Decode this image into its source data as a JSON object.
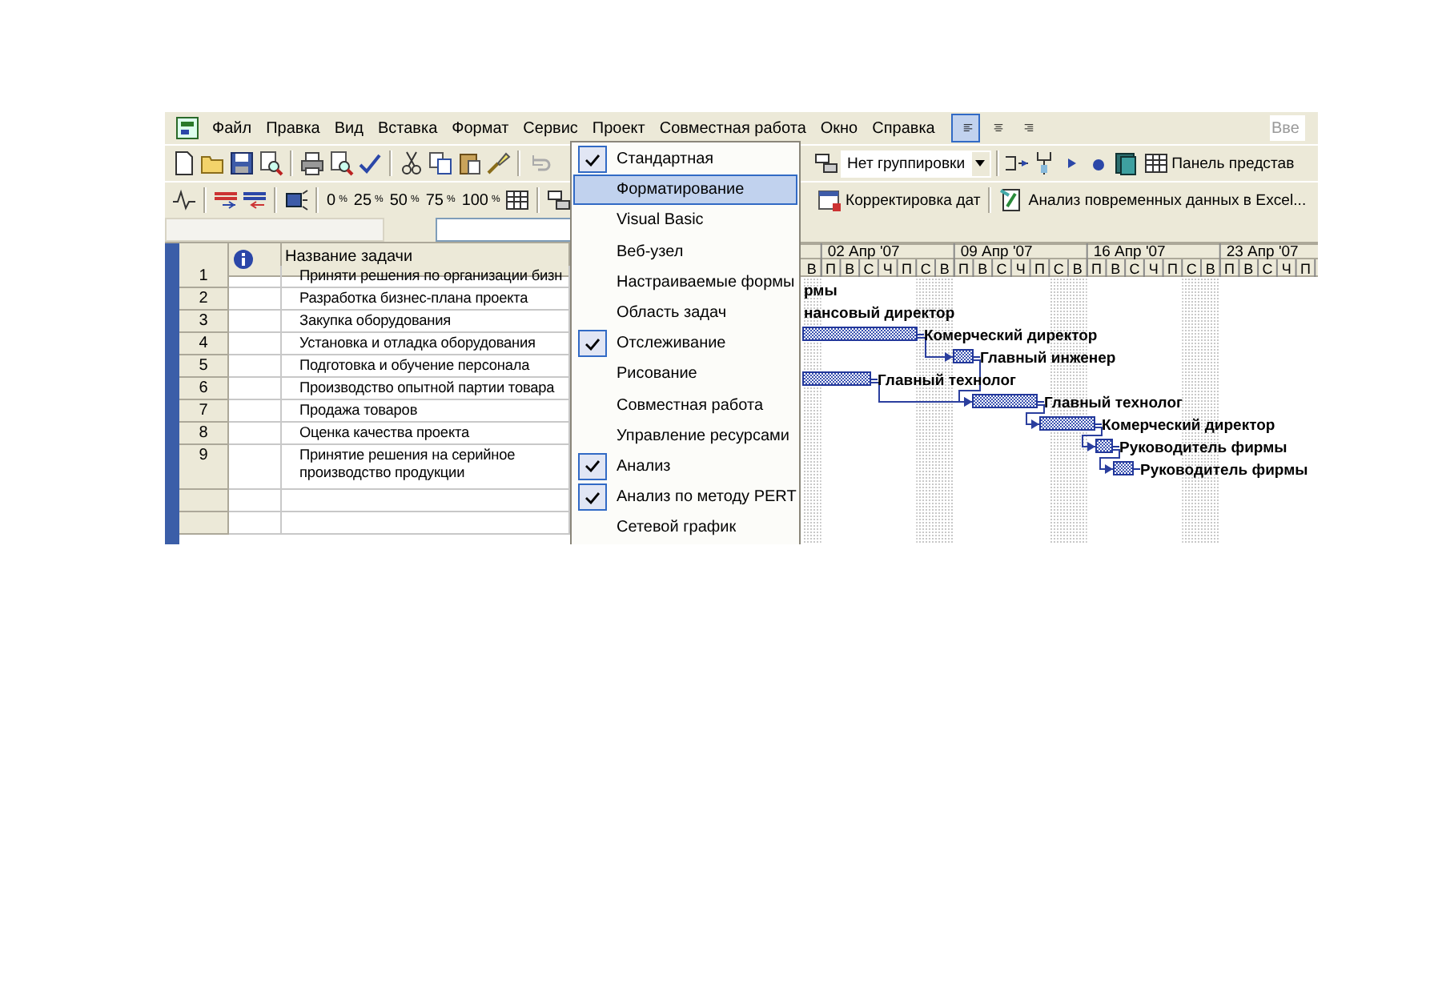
{
  "menu_bar": {
    "items": [
      "Файл",
      "Правка",
      "Вид",
      "Вставка",
      "Формат",
      "Сервис",
      "Проект",
      "Совместная работа",
      "Окно",
      "Справка"
    ],
    "align_buttons": [
      {
        "selected": true
      },
      {
        "selected": false
      },
      {
        "selected": false
      }
    ],
    "question_field": {
      "placeholder": "Вве"
    }
  },
  "standard_toolbar": {
    "grouping_dropdown": "Нет группировки",
    "view_bar_button": "Панель представ"
  },
  "tracking_toolbar": {
    "zoom_buttons": [
      "0$^{%}$",
      "25$^{%}$",
      "50$^{%}$",
      "75$^{%}$",
      "100$^{%}$"
    ],
    "buttons": [
      "Корректировка дат",
      "Анализ повременных данных в Excel..."
    ]
  },
  "task_table": {
    "name_header": "Название задачи",
    "rows": [
      {
        "id": "1",
        "name": "Приняти решения по организации бизн"
      },
      {
        "id": "2",
        "name": "Разработка бизнес-плана проекта"
      },
      {
        "id": "3",
        "name": "Закупка оборудования"
      },
      {
        "id": "4",
        "name": "Установка и отладка оборудования"
      },
      {
        "id": "5",
        "name": "Подготовка и обучение  персонала"
      },
      {
        "id": "6",
        "name": "Производство опытной партии товара"
      },
      {
        "id": "7",
        "name": "Продажа товаров"
      },
      {
        "id": "8",
        "name": "Оценка качества проекта"
      },
      {
        "id": "9",
        "name": "Принятие решения на серийное производство продукции"
      }
    ]
  },
  "gantt": {
    "weeks": [
      "02 Апр '07",
      "09 Апр '07",
      "16 Апр '07",
      "23 Апр '07"
    ],
    "days": [
      "В",
      "П",
      "В",
      "С",
      "Ч",
      "П",
      "С",
      "В",
      "П",
      "В",
      "С",
      "Ч",
      "П",
      "С",
      "В",
      "П",
      "В",
      "С",
      "Ч",
      "П",
      "С",
      "В",
      "П",
      "В",
      "С",
      "Ч",
      "П"
    ],
    "tasks": [
      {
        "resource": "рмы"
      },
      {
        "resource": "нансовый директор"
      },
      {
        "resource": "Комерческий директор"
      },
      {
        "resource": "Главный инженер"
      },
      {
        "resource": "Главный технолог"
      },
      {
        "resource": "Главный технолог"
      },
      {
        "resource": "Комерческий директор"
      },
      {
        "resource": "Руководитель фирмы"
      },
      {
        "resource": "Руководитель фирмы"
      }
    ]
  },
  "toolbars_menu": {
    "items": [
      {
        "label": "Стандартная",
        "checked": true,
        "selected": false
      },
      {
        "label": "Форматирование",
        "checked": false,
        "selected": true
      },
      {
        "label": "Visual Basic",
        "checked": false,
        "selected": false
      },
      {
        "label": "Веб-узел",
        "checked": false,
        "selected": false
      },
      {
        "label": "Настраиваемые формы",
        "checked": false,
        "selected": false
      },
      {
        "label": "Область задач",
        "checked": false,
        "selected": false
      },
      {
        "label": "Отслеживание",
        "checked": true,
        "selected": false
      },
      {
        "label": "Рисование",
        "checked": false,
        "selected": false
      },
      {
        "label": "Совместная работа",
        "checked": false,
        "selected": false
      },
      {
        "label": "Управление ресурсами",
        "checked": false,
        "selected": false
      },
      {
        "label": "Анализ",
        "checked": true,
        "selected": false
      },
      {
        "label": "Анализ по методу PERT",
        "checked": true,
        "selected": false
      },
      {
        "label": "Сетевой график",
        "checked": false,
        "selected": false
      }
    ]
  }
}
